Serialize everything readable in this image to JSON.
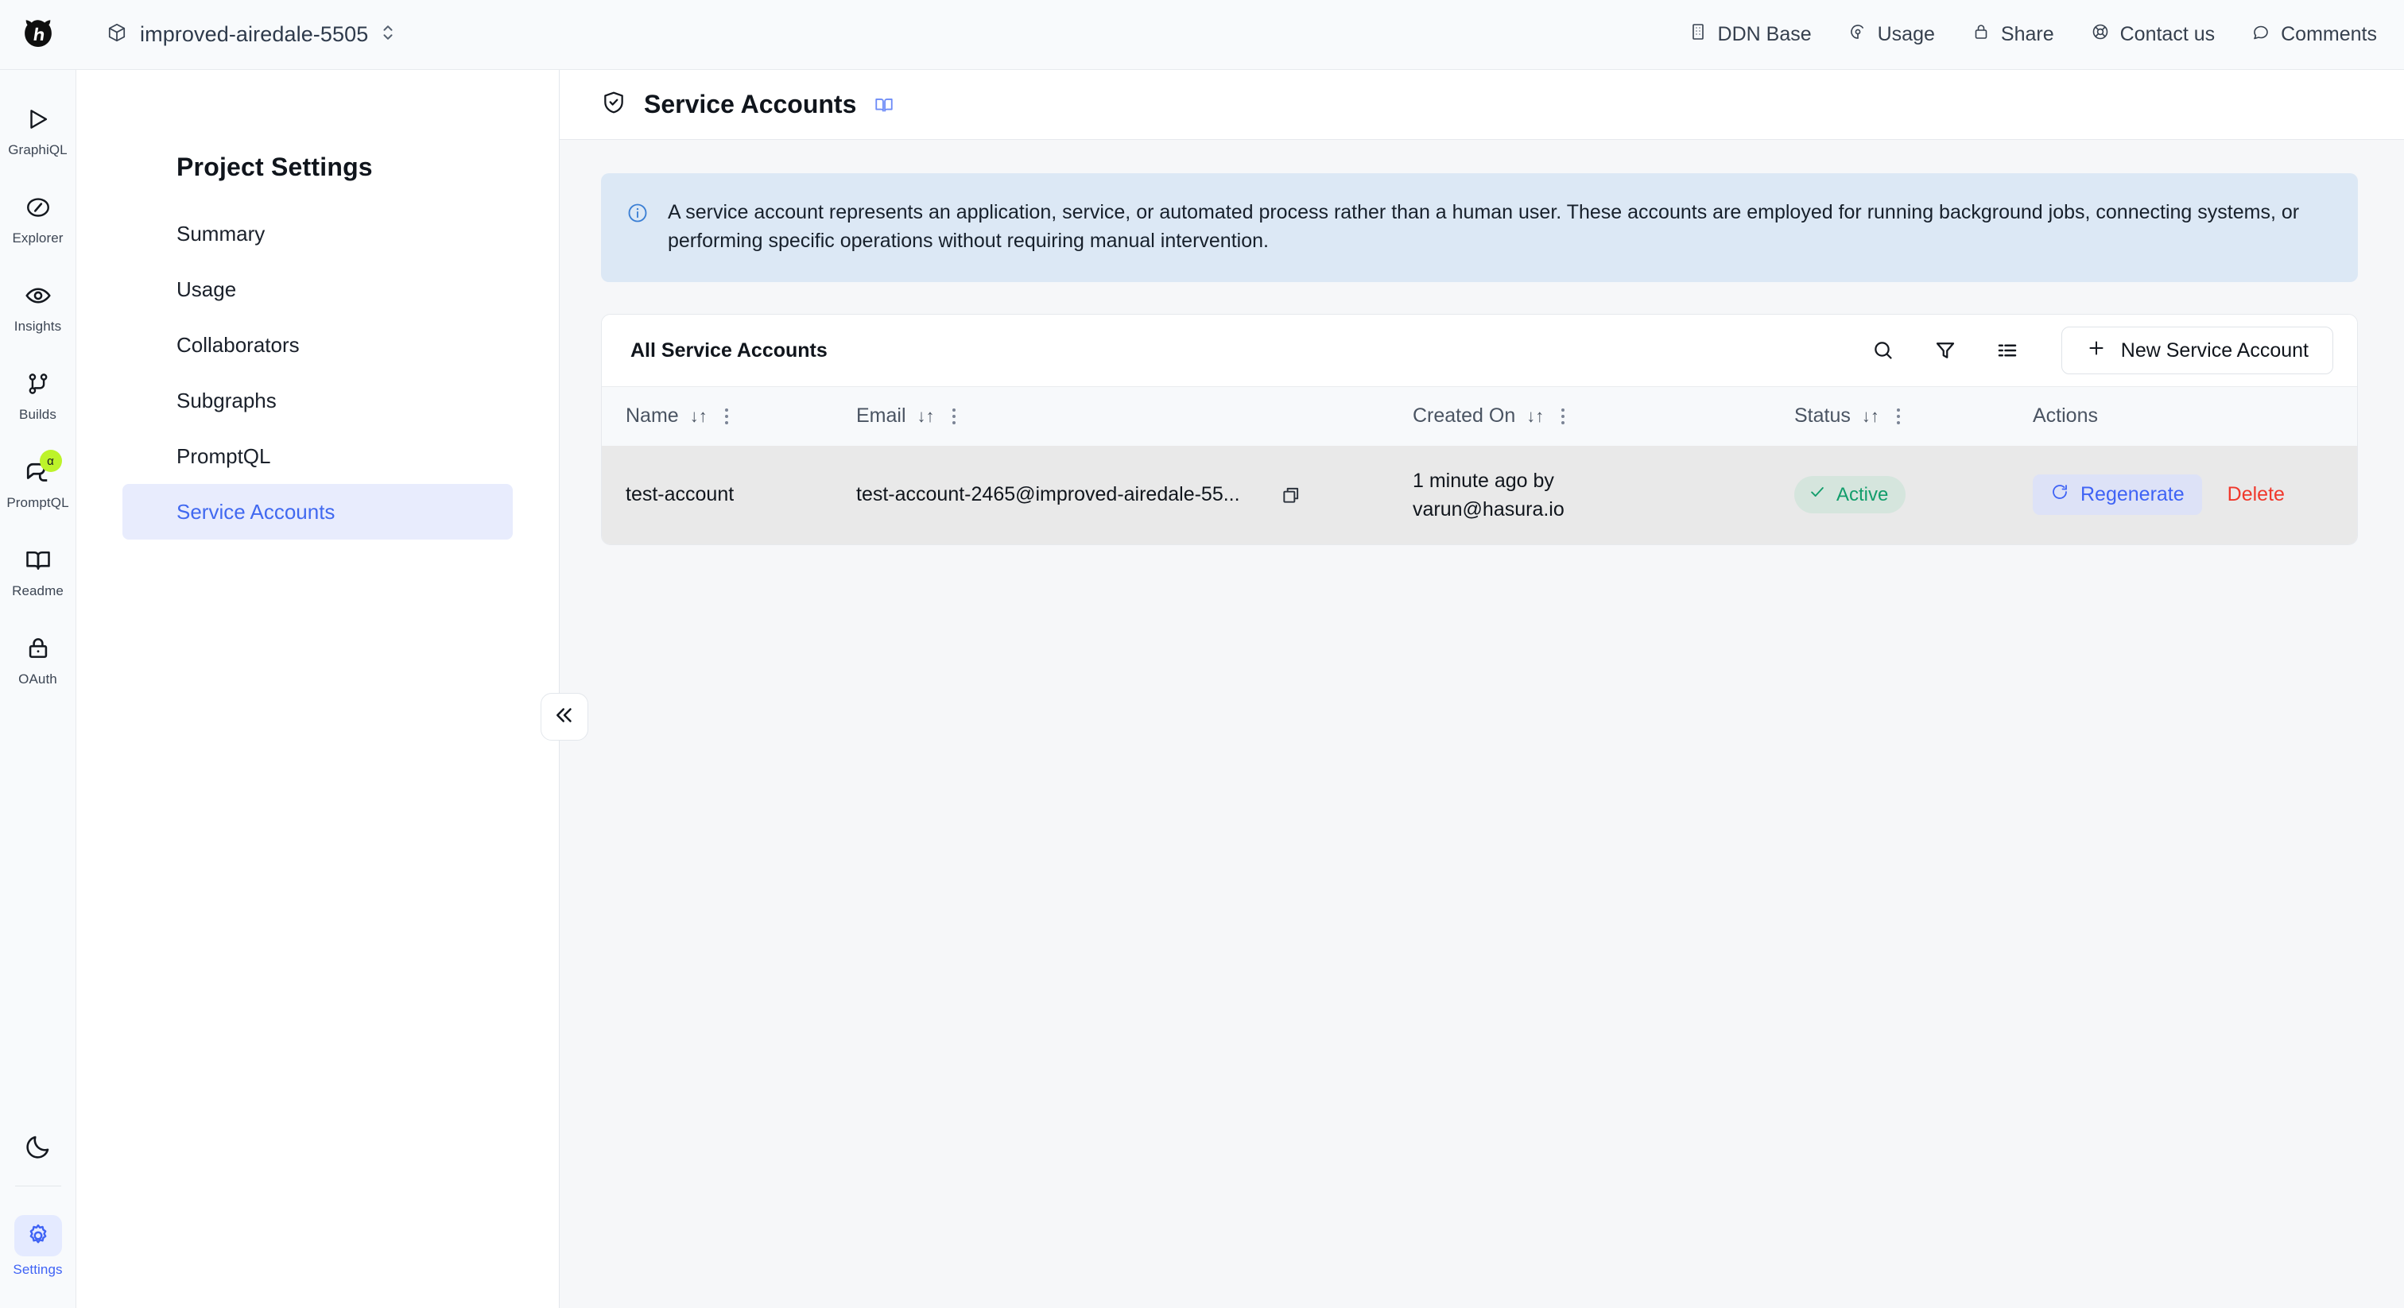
{
  "topbar": {
    "logo_icon": "hasura-logo-icon",
    "project": {
      "icon": "cube-icon",
      "name": "improved-airedale-5505",
      "chevron_icon": "chevron-updown-icon"
    },
    "nav": [
      {
        "icon": "building-icon",
        "label": "DDN Base"
      },
      {
        "icon": "usage-gauge-icon",
        "label": "Usage"
      },
      {
        "icon": "lock-icon",
        "label": "Share"
      },
      {
        "icon": "support-icon",
        "label": "Contact us"
      },
      {
        "icon": "comment-icon",
        "label": "Comments"
      }
    ]
  },
  "rail": {
    "items": [
      {
        "icon": "play-icon",
        "label": "GraphiQL",
        "active": false,
        "badge": ""
      },
      {
        "icon": "compass-icon",
        "label": "Explorer",
        "active": false,
        "badge": ""
      },
      {
        "icon": "eye-icon",
        "label": "Insights",
        "active": false,
        "badge": ""
      },
      {
        "icon": "git-branch-icon",
        "label": "Builds",
        "active": false,
        "badge": ""
      },
      {
        "icon": "chat-icon",
        "label": "PromptQL",
        "active": false,
        "badge": "α"
      },
      {
        "icon": "book-icon",
        "label": "Readme",
        "active": false,
        "badge": ""
      },
      {
        "icon": "lock-icon",
        "label": "OAuth",
        "active": false,
        "badge": ""
      }
    ],
    "theme_toggle": {
      "icon": "moon-icon"
    },
    "settings": {
      "icon": "gear-icon",
      "label": "Settings",
      "active": true
    }
  },
  "settings_panel": {
    "title": "Project Settings",
    "items": [
      {
        "label": "Summary",
        "active": false
      },
      {
        "label": "Usage",
        "active": false
      },
      {
        "label": "Collaborators",
        "active": false
      },
      {
        "label": "Subgraphs",
        "active": false
      },
      {
        "label": "PromptQL",
        "active": false
      },
      {
        "label": "Service Accounts",
        "active": true
      }
    ],
    "collapse_icon": "chevrons-left-icon"
  },
  "page": {
    "icon": "shield-check-icon",
    "title": "Service Accounts",
    "docs_icon": "book-open-icon",
    "info_banner": {
      "icon": "info-icon",
      "text": "A service account represents an application, service, or automated process rather than a human user. These accounts are employed for running background jobs, connecting systems, or performing specific operations without requiring manual intervention."
    }
  },
  "table_card": {
    "toolbar": {
      "title": "All Service Accounts",
      "search_icon": "search-icon",
      "filter_icon": "filter-icon",
      "columns_icon": "columns-list-icon",
      "new_button": {
        "plus_icon": "plus-icon",
        "label": "New Service Account"
      }
    },
    "columns": [
      {
        "label": "Name",
        "sortable": true,
        "menu": true
      },
      {
        "label": "Email",
        "sortable": true,
        "menu": true
      },
      {
        "label": "Created On",
        "sortable": true,
        "menu": true
      },
      {
        "label": "Status",
        "sortable": true,
        "menu": true
      },
      {
        "label": "Actions",
        "sortable": false,
        "menu": false
      }
    ],
    "sort_glyph": "↓↑",
    "rows": [
      {
        "name": "test-account",
        "email": "test-account-2465@improved-airedale-55...",
        "copy_icon": "copy-icon",
        "created_on_line1": "1 minute ago by",
        "created_on_line2": "varun@hasura.io",
        "status": {
          "label": "Active",
          "icon": "check-icon",
          "color": "#129d6b"
        },
        "actions": {
          "regenerate": {
            "icon": "refresh-icon",
            "label": "Regenerate"
          },
          "delete": {
            "label": "Delete"
          }
        }
      }
    ]
  },
  "annotation": {
    "type": "arrow",
    "color": "#ff2d16",
    "points_to": "Regenerate"
  }
}
